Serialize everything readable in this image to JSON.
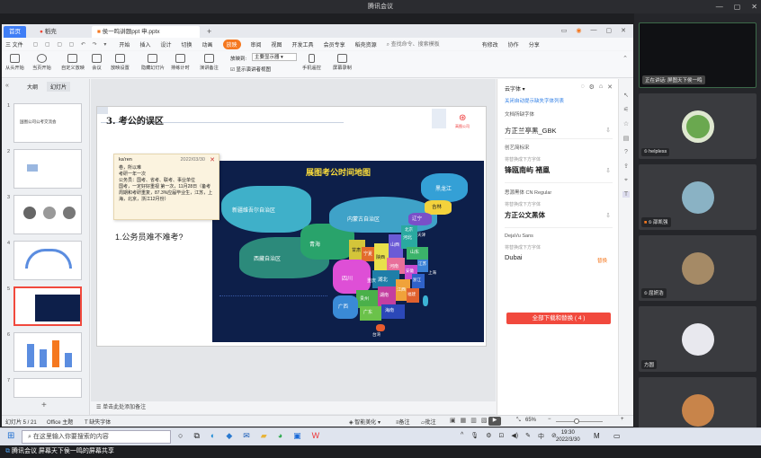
{
  "meeting": {
    "title": "腾讯会议",
    "share_label": "腾讯会议",
    "share_bar": "腾讯会议 屏幕天下侯一鸣的屏幕共享"
  },
  "tabs": [
    "首页",
    "稻壳",
    "侯一鸣讲题ppt 申.pptx"
  ],
  "menu": [
    "三 文件",
    "开始",
    "插入",
    "设计",
    "切换",
    "动画",
    "放映",
    "审阅",
    "视图",
    "开发工具",
    "会员专享",
    "稻壳资源",
    "查找命令、搜索模板",
    "有修改",
    "协作",
    "分享"
  ],
  "ribbon": [
    "从头开始",
    "当页开始",
    "自定义放映",
    "会议",
    "放映设置",
    "隐藏幻灯片",
    "排练计时",
    "演讲备注",
    "放映到:",
    "主要显示器",
    "显示演讲者视图",
    "手机遥控",
    "屏幕录制"
  ],
  "left_tabs": [
    "大纲",
    "幻灯片"
  ],
  "slide_numbers": [
    "1",
    "2",
    "3",
    "4",
    "5",
    "6",
    "7"
  ],
  "thumb1_text": "国图公司公考交流会",
  "slide": {
    "heading": "3. 考公的误区",
    "logo": "高图公司",
    "body": "1.公务员难不难考?",
    "map_title": "展图考公时间地图",
    "regions": [
      "黑龙江",
      "吉林",
      "辽宁",
      "内蒙古自治区",
      "新疆维吾尔自治区",
      "西藏自治区",
      "青海",
      "甘肃",
      "宁夏",
      "陕西",
      "山西",
      "河北",
      "北京",
      "天津",
      "山东",
      "河南",
      "江苏",
      "安徽",
      "上海",
      "湖北",
      "四川",
      "重庆",
      "贵州",
      "湖南",
      "江西",
      "浙江",
      "福建",
      "云南",
      "广西",
      "广东",
      "海南",
      "台湾"
    ]
  },
  "comment": {
    "author": "ka'ren",
    "date": "2022/03/30",
    "text": "卷，所以难\n考研一年一次\n公务员：国考、省考、联考、事业单位\n国考，一定好好重视 第一次，11月28日（备考周期和考研重复，87.3%应届毕业生，江苏，上海，北京，浙江12月份）"
  },
  "notes_placeholder": "单击此处添加备注",
  "cloud_font": {
    "title": "云字体",
    "link": "关闭自动提示缺失字体列表",
    "section": "文档所缺字体",
    "fonts": [
      {
        "name": "方正兰亭黑_GBK",
        "sub": ""
      },
      {
        "name": "创艺简标宋",
        "sub": "将替换成下方字体",
        "replace": "锋瓯南屿 褚鳯"
      },
      {
        "name": "思源黑体 CN Regular",
        "sub": "将替换成下方字体",
        "replace": "方正公文黑体"
      },
      {
        "name": "DejaVu Sans",
        "sub": "将替换成下方字体",
        "replace": "Dubai",
        "tag": "替换"
      }
    ],
    "button": "全部下载和替换 ( 4 )"
  },
  "status": {
    "slide": "幻灯片 5 / 21",
    "theme": "Office 主题",
    "font_missing": "缺失字体",
    "smart": "智能美化",
    "notes": "备注",
    "comment": "批注",
    "zoom": "65%"
  },
  "participants": [
    {
      "name": "正在讲话: 屏图天下侯一鸣"
    },
    {
      "name": "helpless"
    },
    {
      "name": "邵凯强"
    },
    {
      "name": "屈妍浩"
    },
    {
      "name": "方圆"
    },
    {
      "name": "徐金"
    }
  ],
  "taskbar": {
    "search": "在这里输入你要搜索的内容",
    "time": "19:30",
    "date": "2022/3/30",
    "lang": "中"
  },
  "colors": {
    "accent": "#f1493d",
    "wps_orange": "#f5781f",
    "map_bg": "#0d1f4a",
    "tab_active": "#ffffff"
  }
}
